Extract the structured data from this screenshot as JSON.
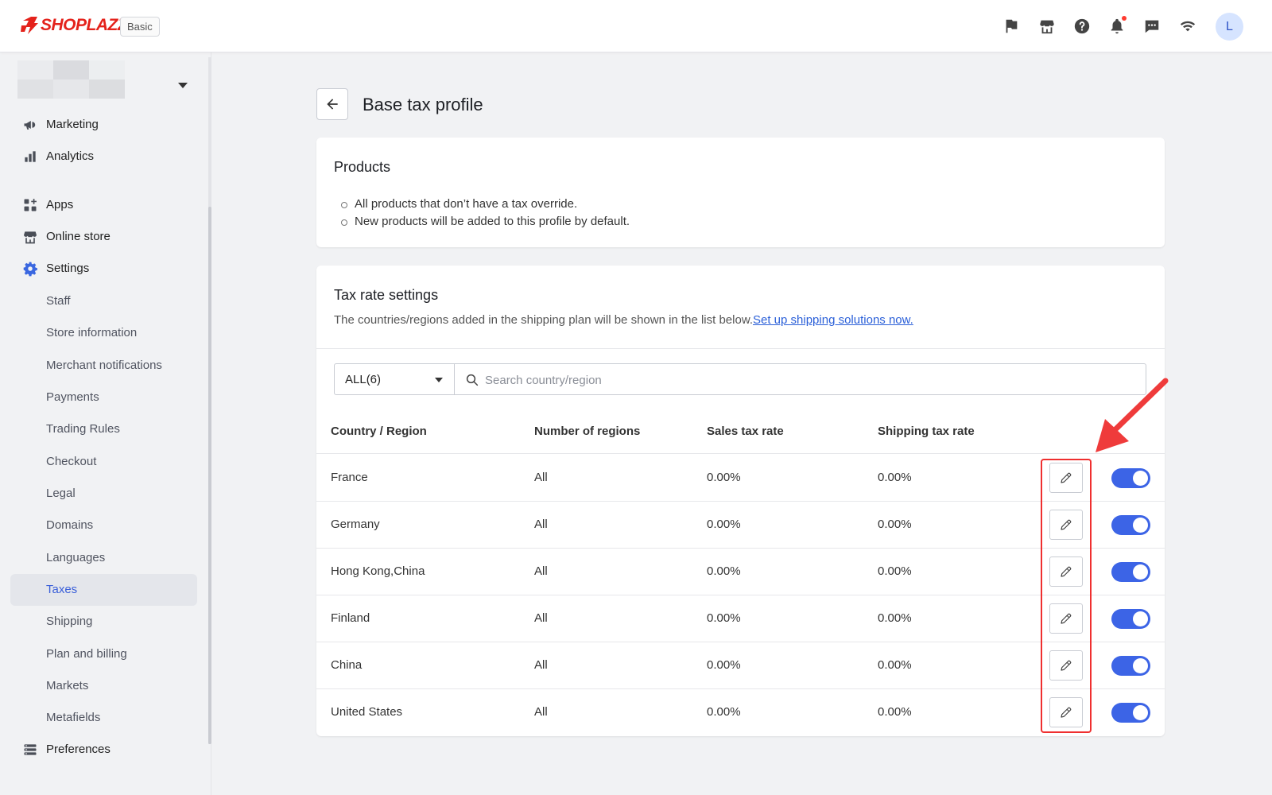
{
  "app": {
    "brand": "SHOPLAZZA",
    "plan_badge": "Basic",
    "avatar_initial": "L",
    "icons": [
      "flag-icon",
      "store-icon",
      "help-icon",
      "bell-icon",
      "chat-icon",
      "wifi-icon"
    ]
  },
  "sidebar": {
    "main_items": [
      {
        "label": "Marketing",
        "icon": "megaphone-icon"
      },
      {
        "label": "Analytics",
        "icon": "bar-chart-icon"
      },
      {
        "label": "Apps",
        "icon": "apps-icon"
      },
      {
        "label": "Online store",
        "icon": "store-icon"
      },
      {
        "label": "Settings",
        "icon": "gear-icon"
      }
    ],
    "settings_items": [
      "Staff",
      "Store information",
      "Merchant notifications",
      "Payments",
      "Trading Rules",
      "Checkout",
      "Legal",
      "Domains",
      "Languages",
      "Taxes",
      "Shipping",
      "Plan and billing",
      "Markets",
      "Metafields"
    ],
    "active_item": "Taxes",
    "preferences": {
      "label": "Preferences",
      "icon": "preferences-icon"
    }
  },
  "page": {
    "title": "Base tax profile"
  },
  "products_card": {
    "title": "Products",
    "bullets": [
      "All products that don’t have a tax override.",
      "New products will be added to this profile by default."
    ]
  },
  "tax_card": {
    "title": "Tax rate settings",
    "description": "The countries/regions added in the shipping plan will be shown in the list below.",
    "link_text": "Set up shipping solutions now.",
    "filter_value": "ALL(6)",
    "search_placeholder": "Search country/region",
    "columns": [
      "Country / Region",
      "Number of regions",
      "Sales tax rate",
      "Shipping tax rate"
    ],
    "rows": [
      {
        "country": "France",
        "regions": "All",
        "sales": "0.00%",
        "shipping": "0.00%",
        "enabled": true
      },
      {
        "country": "Germany",
        "regions": "All",
        "sales": "0.00%",
        "shipping": "0.00%",
        "enabled": true
      },
      {
        "country": "Hong Kong,China",
        "regions": "All",
        "sales": "0.00%",
        "shipping": "0.00%",
        "enabled": true
      },
      {
        "country": "Finland",
        "regions": "All",
        "sales": "0.00%",
        "shipping": "0.00%",
        "enabled": true
      },
      {
        "country": "China",
        "regions": "All",
        "sales": "0.00%",
        "shipping": "0.00%",
        "enabled": true
      },
      {
        "country": "United States",
        "regions": "All",
        "sales": "0.00%",
        "shipping": "0.00%",
        "enabled": true
      }
    ]
  },
  "colors": {
    "brand": "#e4221b",
    "accent": "#3c64e6",
    "link": "#2a5fd8",
    "annotation": "#ef2f2f"
  }
}
